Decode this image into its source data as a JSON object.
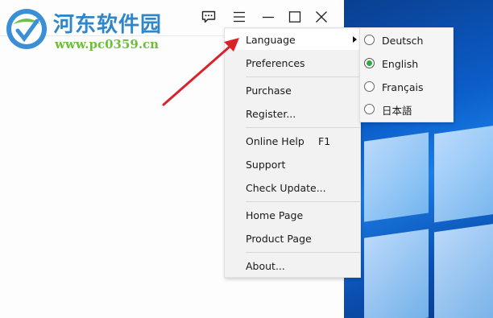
{
  "watermark": {
    "title": "河东软件园",
    "url": "www.pc0359.cn"
  },
  "titlebar": {
    "icons": [
      "chat-feedback-icon",
      "hamburger-menu-icon",
      "minimize-icon",
      "maximize-icon",
      "close-icon"
    ]
  },
  "menu": {
    "items": [
      {
        "label": "Language",
        "has_submenu": true,
        "highlighted": true
      },
      {
        "label": "Preferences"
      },
      {
        "label": "Purchase"
      },
      {
        "label": "Register..."
      },
      {
        "label": "Online Help",
        "shortcut": "F1"
      },
      {
        "label": "Support"
      },
      {
        "label": "Check Update..."
      },
      {
        "label": "Home Page"
      },
      {
        "label": "Product Page"
      },
      {
        "label": "About..."
      }
    ]
  },
  "language_submenu": {
    "options": [
      {
        "label": "Deutsch",
        "selected": false
      },
      {
        "label": "English",
        "selected": true
      },
      {
        "label": "Français",
        "selected": false
      },
      {
        "label": "日本語",
        "selected": false
      }
    ]
  },
  "colors": {
    "radio_selected": "#2eaa3e",
    "annotation_arrow": "#d9232a",
    "watermark_title": "#2f86c9",
    "watermark_url": "#6cbf3a"
  }
}
